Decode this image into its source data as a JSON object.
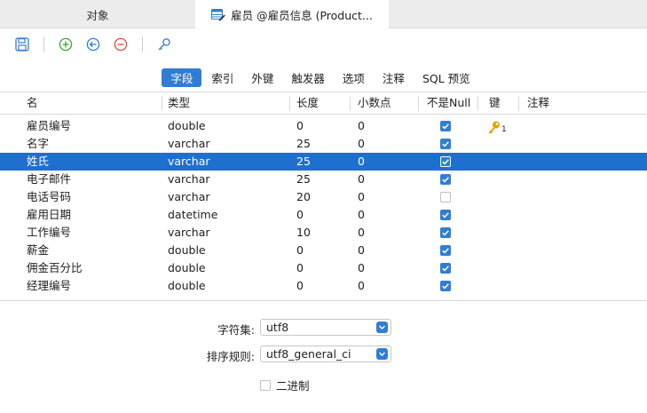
{
  "tabs": [
    {
      "label": "对象",
      "active": false
    },
    {
      "label": "雇员 @雇员信息 (Product...",
      "active": true,
      "icon": "table-edit-icon"
    }
  ],
  "toolbar": {
    "buttons": [
      {
        "name": "save-button",
        "icon": "save-icon"
      },
      {
        "name": "add-field-button",
        "icon": "plus-circle-icon"
      },
      {
        "name": "insert-field-button",
        "icon": "arrow-left-circle-icon"
      },
      {
        "name": "delete-field-button",
        "icon": "minus-circle-icon"
      },
      {
        "name": "primary-key-button",
        "icon": "key-icon"
      }
    ]
  },
  "subtabs": [
    "字段",
    "索引",
    "外键",
    "触发器",
    "选项",
    "注释",
    "SQL 预览"
  ],
  "columns": [
    "名",
    "类型",
    "长度",
    "小数点",
    "不是Null",
    "键",
    "注释"
  ],
  "rows": [
    {
      "name": "雇员编号",
      "type": "double",
      "length": "0",
      "decimals": "0",
      "not_null": true,
      "key": "1",
      "selected": false
    },
    {
      "name": "名字",
      "type": "varchar",
      "length": "25",
      "decimals": "0",
      "not_null": true,
      "key": "",
      "selected": false
    },
    {
      "name": "姓氏",
      "type": "varchar",
      "length": "25",
      "decimals": "0",
      "not_null": true,
      "key": "",
      "selected": true
    },
    {
      "name": "电子邮件",
      "type": "varchar",
      "length": "25",
      "decimals": "0",
      "not_null": true,
      "key": "",
      "selected": false
    },
    {
      "name": "电话号码",
      "type": "varchar",
      "length": "20",
      "decimals": "0",
      "not_null": false,
      "key": "",
      "selected": false
    },
    {
      "name": "雇用日期",
      "type": "datetime",
      "length": "0",
      "decimals": "0",
      "not_null": true,
      "key": "",
      "selected": false
    },
    {
      "name": "工作编号",
      "type": "varchar",
      "length": "10",
      "decimals": "0",
      "not_null": true,
      "key": "",
      "selected": false
    },
    {
      "name": "薪金",
      "type": "double",
      "length": "0",
      "decimals": "0",
      "not_null": true,
      "key": "",
      "selected": false
    },
    {
      "name": "佣金百分比",
      "type": "double",
      "length": "0",
      "decimals": "0",
      "not_null": true,
      "key": "",
      "selected": false
    },
    {
      "name": "经理编号",
      "type": "double",
      "length": "0",
      "decimals": "0",
      "not_null": true,
      "key": "",
      "selected": false
    }
  ],
  "properties": {
    "charset_label": "字符集:",
    "charset_value": "utf8",
    "collation_label": "排序规则:",
    "collation_value": "utf8_general_ci",
    "binary_label": "二进制",
    "binary_checked": false
  },
  "colors": {
    "accent": "#2f7dd6",
    "selection": "#1f6fd1",
    "key": "#e2a400"
  }
}
